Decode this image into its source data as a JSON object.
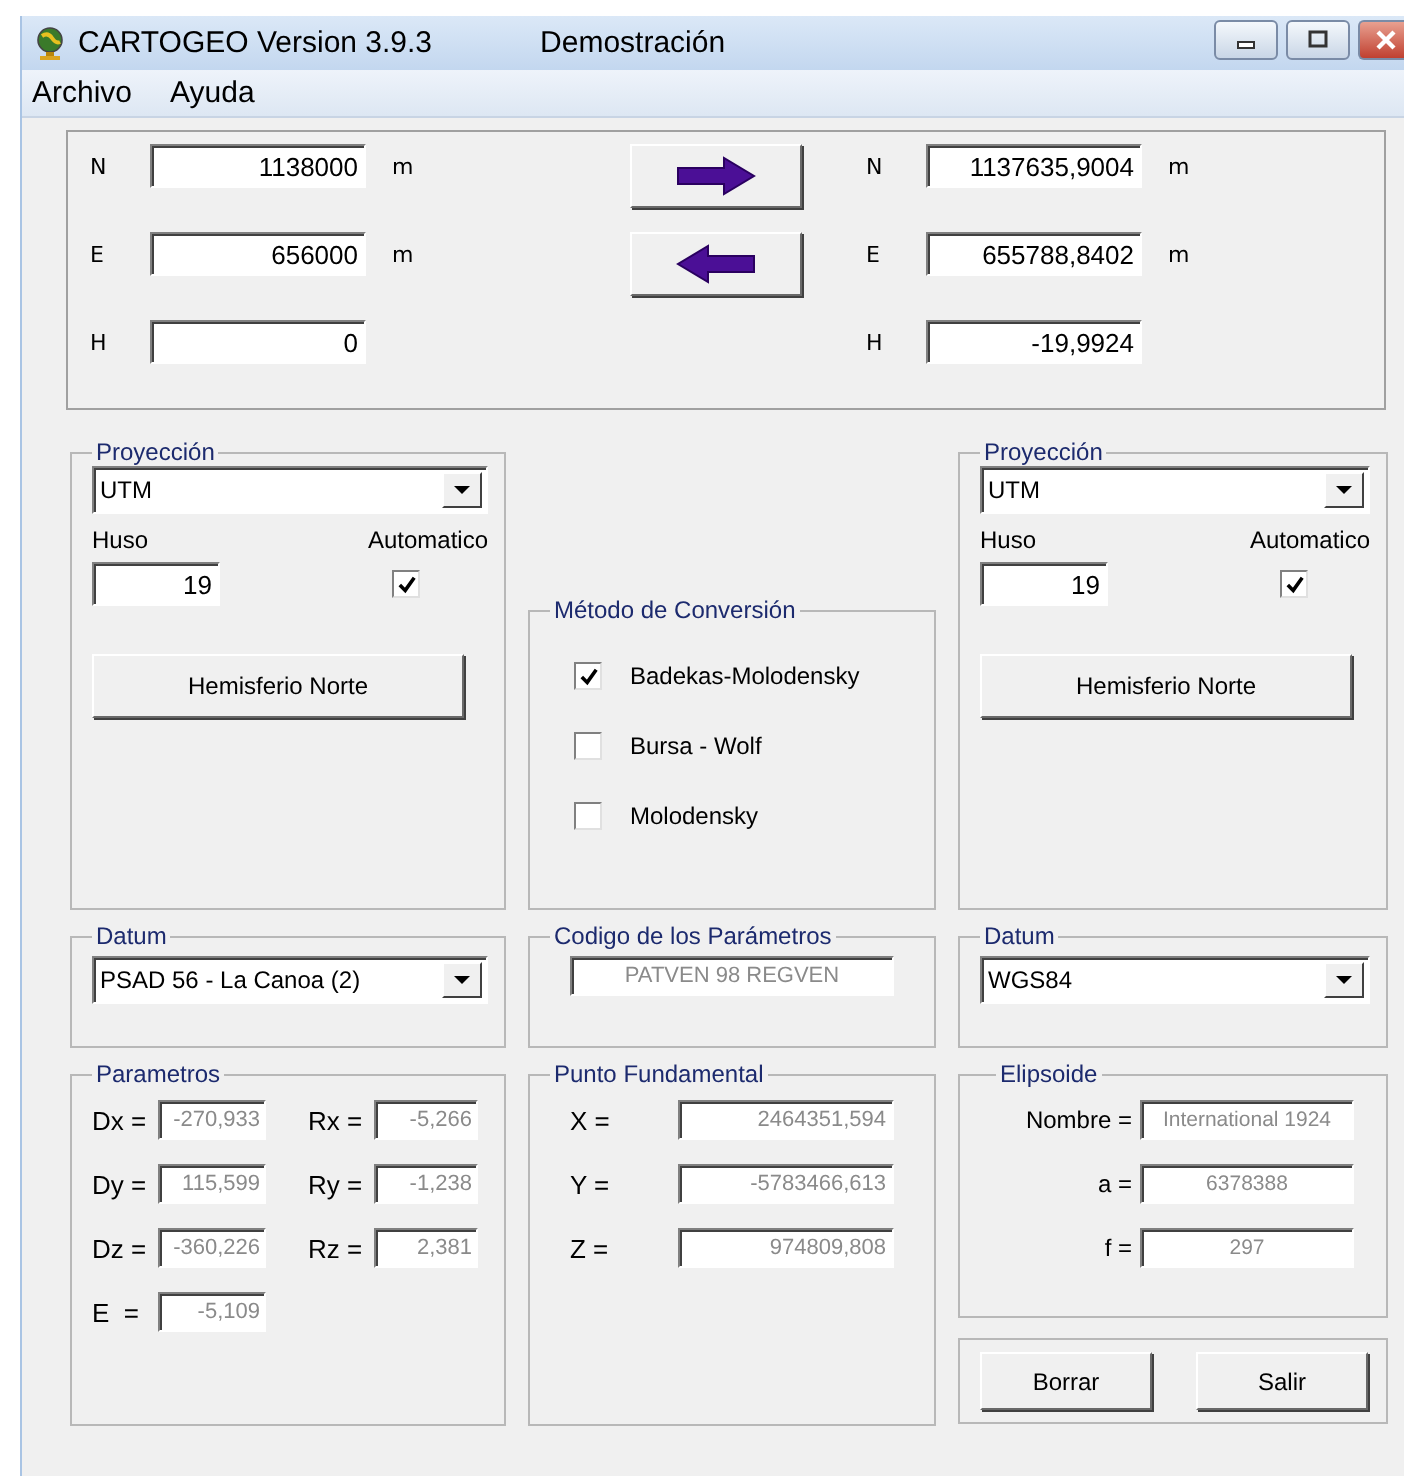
{
  "window": {
    "title": "CARTOGEO Version 3.9.3",
    "subtitle": "Demostración"
  },
  "menu": [
    "Archivo",
    "Ayuda"
  ],
  "source": [
    {
      "label": "N",
      "value": "1138000",
      "unit": "m"
    },
    {
      "label": "E",
      "value": "656000",
      "unit": "m"
    },
    {
      "label": "H",
      "value": "0"
    }
  ],
  "target": [
    {
      "label": "N",
      "value": "1137635,9004",
      "unit": "m"
    },
    {
      "label": "E",
      "value": "655788,8402",
      "unit": "m"
    },
    {
      "label": "H",
      "value": "-19,9924"
    }
  ],
  "projection_left": {
    "legend": "Proyección",
    "value": "UTM",
    "huso_label": "Huso",
    "huso": "19",
    "auto_label": "Automatico",
    "automatic": true,
    "hemisphere_button": "Hemisferio Norte"
  },
  "method": {
    "legend": "Método de Conversión",
    "options": [
      {
        "label": "Badekas-Molodensky",
        "checked": true
      },
      {
        "label": "Bursa - Wolf",
        "checked": false
      },
      {
        "label": "Molodensky",
        "checked": false
      }
    ]
  },
  "projection_right": {
    "legend": "Proyección",
    "value": "UTM",
    "huso_label": "Huso",
    "huso": "19",
    "auto_label": "Automatico",
    "automatic": true,
    "hemisphere_button": "Hemisferio Norte"
  },
  "datum_left": {
    "legend": "Datum",
    "value": "PSAD 56 - La Canoa (2)"
  },
  "code": {
    "legend": "Codigo de los Parámetros",
    "value": "PATVEN 98 REGVEN"
  },
  "datum_right": {
    "legend": "Datum",
    "value": "WGS84"
  },
  "parameters": {
    "legend": "Parametros",
    "fields": [
      {
        "label": "Dx =",
        "value": "-270,933"
      },
      {
        "label": "Rx =",
        "value": "-5,266"
      },
      {
        "label": "Dy =",
        "value": "115,599"
      },
      {
        "label": "Ry =",
        "value": "-1,238"
      },
      {
        "label": "Dz =",
        "value": "-360,226"
      },
      {
        "label": "Rz =",
        "value": "2,381"
      },
      {
        "label": "E  =",
        "value": "-5,109"
      }
    ]
  },
  "fundamental_point": {
    "legend": "Punto Fundamental",
    "fields": [
      {
        "label": "X =",
        "value": "2464351,594"
      },
      {
        "label": "Y =",
        "value": "-5783466,613"
      },
      {
        "label": "Z =",
        "value": "974809,808"
      }
    ]
  },
  "ellipsoid": {
    "legend": "Elipsoide",
    "fields": [
      {
        "label": "Nombre =",
        "value": "International 1924"
      },
      {
        "label": "a =",
        "value": "6378388"
      },
      {
        "label": "f =",
        "value": "297"
      }
    ]
  },
  "buttons": [
    "Borrar",
    "Salir"
  ]
}
